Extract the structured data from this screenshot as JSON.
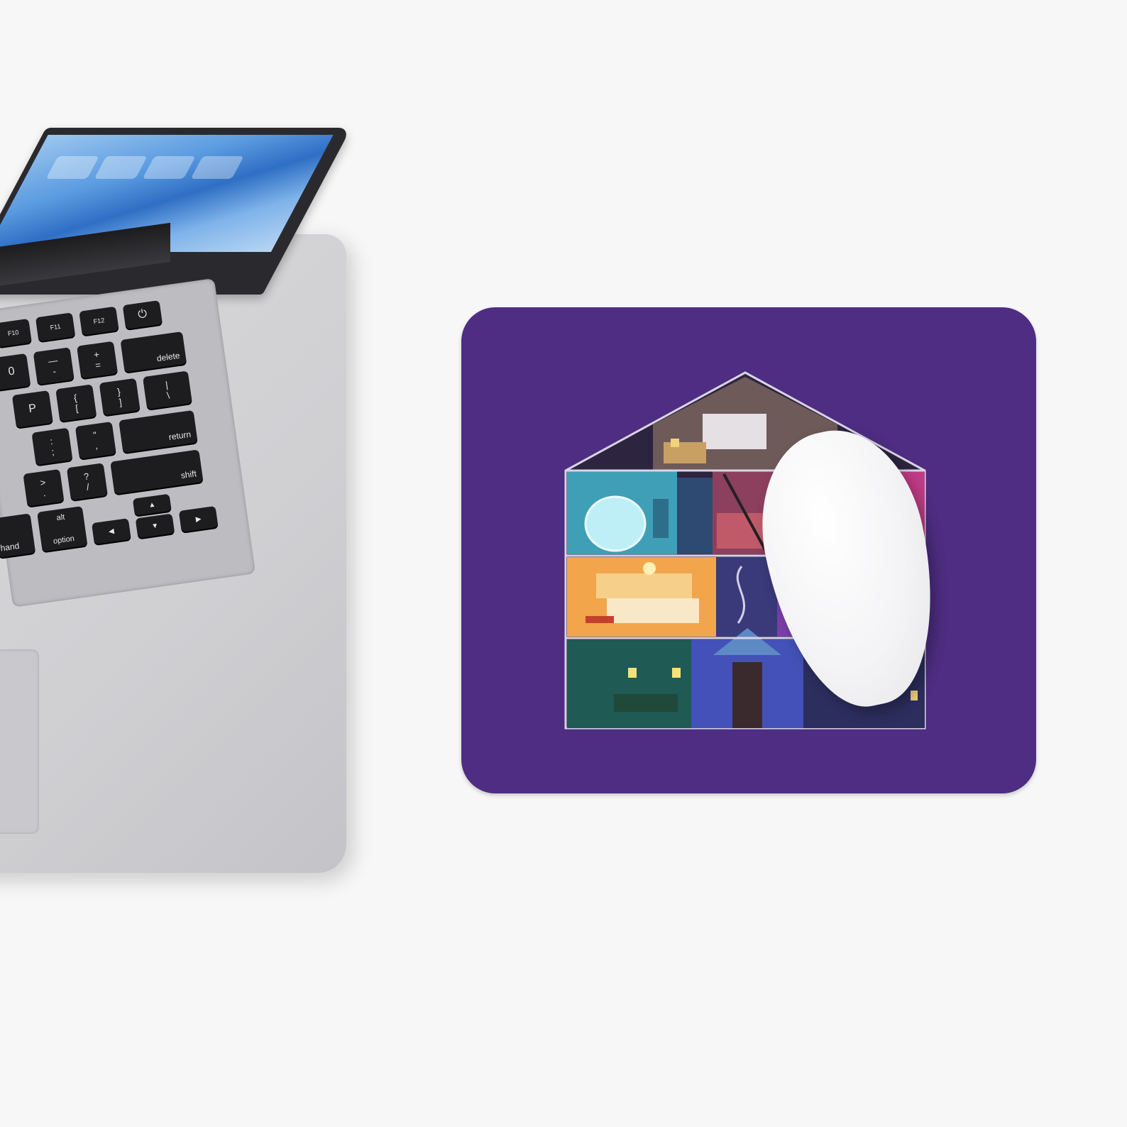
{
  "scene": {
    "description_colors": {
      "background": "#f7f7f7",
      "mousepad": "#4e2d82",
      "laptop_body": "#d4d4d7",
      "mouse": "#f4f4f6"
    }
  },
  "laptop": {
    "keys": {
      "f10": "F10",
      "f11": "F11",
      "f12": "F12",
      "power": "⏻",
      "minus_top": "—",
      "minus_bottom": "-",
      "plus_top": "+",
      "plus_bottom": "=",
      "delete": "delete",
      "zero": "0",
      "p": "P",
      "brace_open_top": "{",
      "brace_open_bottom": "[",
      "brace_close_top": "}",
      "brace_close_bottom": "]",
      "pipe_top": "|",
      "pipe_bottom": "\\",
      "colon_top": ":",
      "colon_bottom": ";",
      "quote_top": "\"",
      "quote_bottom": ",",
      "return": "return",
      "gt_top": ">",
      "gt_bottom": ".",
      "question_top": "?",
      "question_bottom": "/",
      "shift": "shift",
      "command": "hand",
      "alt": "alt",
      "option": "option",
      "arrow_up": "▲",
      "arrow_left": "◀",
      "arrow_down": "▼",
      "arrow_right": "▶"
    }
  }
}
